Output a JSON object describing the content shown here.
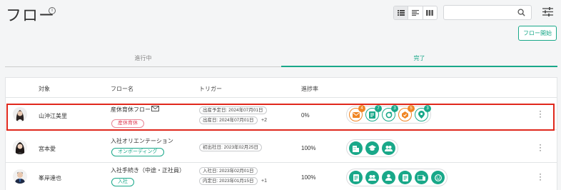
{
  "header": {
    "title": "フロー",
    "info_icon": "info-icon",
    "search_placeholder": "",
    "start_button": "フロー開始"
  },
  "tabs": [
    {
      "label": "進行中",
      "active": false
    },
    {
      "label": "完了",
      "active": true
    }
  ],
  "table": {
    "headers": [
      "対象",
      "フロー名",
      "トリガー",
      "進捗率"
    ],
    "rows": [
      {
        "name": "山沖江美里",
        "flow": "産休育休フロー",
        "tag": "産休育休",
        "triggers": [
          "出産予定日: 2024年07月01日",
          "出産日: 2024年07月01日"
        ],
        "extra": "+2",
        "rate": "0%",
        "icons": [
          {
            "icon": "mail-icon",
            "badge": "4",
            "color": "#f08524"
          },
          {
            "icon": "document-icon",
            "badge": "7",
            "color": "#19a889"
          },
          {
            "icon": "refresh-icon",
            "badge": "3",
            "color": "#19a889"
          },
          {
            "icon": "checklist-icon",
            "badge": "5",
            "color": "#f08524"
          },
          {
            "icon": "location-icon",
            "badge": "3",
            "color": "#19a889"
          }
        ]
      },
      {
        "name": "宮本愛",
        "flow": "入社オリエンテーション",
        "tag": "オンボーディング",
        "triggers": [
          "初出社日: 2023年02月25日"
        ],
        "extra": "",
        "rate": "100%",
        "icons": [
          {
            "icon": "building-icon"
          },
          {
            "icon": "graduation-cap-icon"
          },
          {
            "icon": "people-icon"
          }
        ]
      },
      {
        "name": "峯岸達也",
        "flow": "入社手続き（中途・正社員）",
        "tag": "入社",
        "triggers": [
          "入社日: 2023年02月01日",
          "内定日: 2023年01月15日"
        ],
        "extra": "+1",
        "rate": "100%",
        "icons": [
          {
            "icon": "document-icon"
          },
          {
            "icon": "people-icon"
          },
          {
            "icon": "person-icon"
          },
          {
            "icon": "document-icon"
          },
          {
            "icon": "device-icon"
          },
          {
            "icon": "smile-icon"
          }
        ]
      }
    ]
  },
  "colors": {
    "accent": "#19a889",
    "warning": "#f08524",
    "highlight_border": "#e0281c",
    "tag_pink": "#e0445a"
  }
}
